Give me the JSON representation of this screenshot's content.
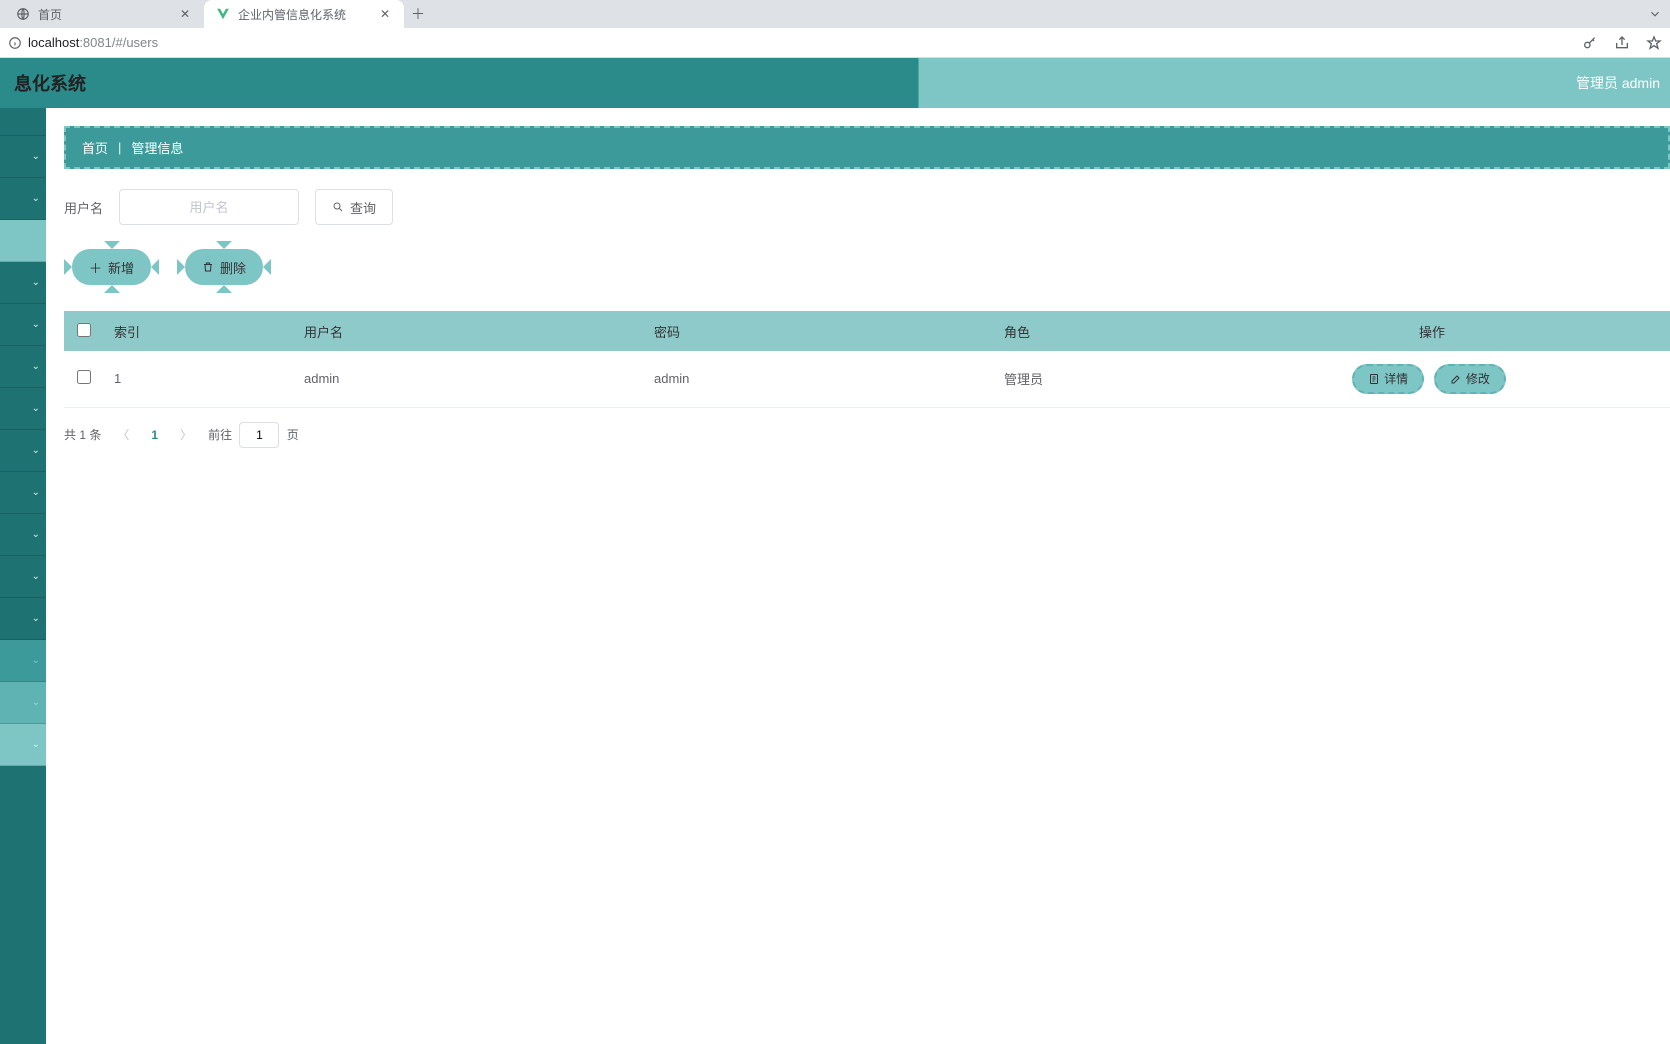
{
  "browser": {
    "tabs": [
      {
        "title": "首页",
        "favicon": "globe"
      },
      {
        "title": "企业内管信息化系统",
        "favicon": "vue"
      }
    ],
    "url_host": "localhost",
    "url_port": ":8081",
    "url_path": "/#/users"
  },
  "header": {
    "title": "息化系统",
    "user": "管理员 admin"
  },
  "breadcrumb": {
    "home": "首页",
    "current": "管理信息"
  },
  "search": {
    "label": "用户名",
    "placeholder": "用户名",
    "query_btn": "查询"
  },
  "actions": {
    "add": "新增",
    "delete": "删除"
  },
  "table": {
    "cols": {
      "index": "索引",
      "username": "用户名",
      "password": "密码",
      "role": "角色",
      "ops": "操作"
    },
    "rows": [
      {
        "index": "1",
        "username": "admin",
        "password": "admin",
        "role": "管理员"
      }
    ],
    "row_ops": {
      "detail": "详情",
      "edit": "修改"
    }
  },
  "pagination": {
    "total": "共 1 条",
    "current": "1",
    "goto_prefix": "前往",
    "goto_value": "1",
    "goto_suffix": "页"
  }
}
